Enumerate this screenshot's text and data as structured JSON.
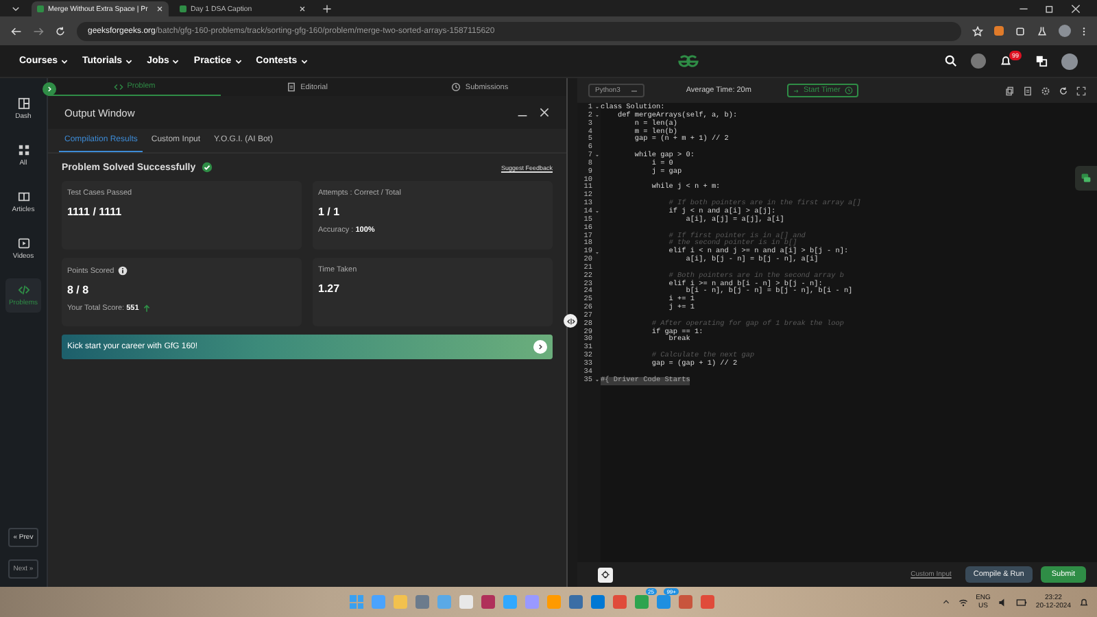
{
  "browser": {
    "tabs": [
      {
        "title": "Merge Without Extra Space | Pr",
        "selected": true
      },
      {
        "title": "Day 1 DSA Caption",
        "selected": false
      }
    ],
    "url": {
      "domain": "geeksforgeeks.org",
      "path": "/batch/gfg-160-problems/track/sorting-gfg-160/problem/merge-two-sorted-arrays-1587115620"
    }
  },
  "site_nav": {
    "menus": [
      "Courses",
      "Tutorials",
      "Jobs",
      "Practice",
      "Contests"
    ],
    "notification_badge": "99"
  },
  "sidebar": {
    "items": [
      {
        "label": "Dash",
        "selected": false
      },
      {
        "label": "All",
        "selected": false
      },
      {
        "label": "Articles",
        "selected": false
      },
      {
        "label": "Videos",
        "selected": false
      },
      {
        "label": "Problems",
        "selected": true
      }
    ],
    "prev": "« Prev",
    "next": "Next »"
  },
  "problem_tabs": [
    {
      "label": "Problem",
      "selected": true
    },
    {
      "label": "Editorial",
      "selected": false
    },
    {
      "label": "Submissions",
      "selected": false
    }
  ],
  "output_window": {
    "title": "Output Window",
    "tabs": [
      {
        "label": "Compilation Results",
        "selected": true
      },
      {
        "label": "Custom Input",
        "selected": false
      },
      {
        "label": "Y.O.G.I. (AI Bot)",
        "selected": false
      }
    ],
    "status": "Problem Solved Successfully",
    "feedback_link": "Suggest Feedback",
    "cards": [
      {
        "label": "Test Cases Passed",
        "value": "1111 / 1111"
      },
      {
        "label": "Attempts : Correct / Total",
        "value": "1 / 1",
        "note": "Accuracy : **100%**"
      },
      {
        "label": "Points Scored",
        "value": "8 / 8",
        "note": "Your Total Score: **551**",
        "info": true,
        "trend_up": true
      },
      {
        "label": "Time Taken",
        "value": "1.27"
      }
    ],
    "banner": "Kick start your career with GfG 160!"
  },
  "editor": {
    "language": "Python3",
    "average_time": "Average Time: 20m",
    "timer_button": "Start Timer",
    "lines": [
      {
        "n": "1",
        "text": "class Solution:",
        "kind": "code",
        "foldable": true
      },
      {
        "n": "2",
        "text": "    def mergeArrays(self, a, b):",
        "kind": "code",
        "foldable": true
      },
      {
        "n": "3",
        "text": "        n = len(a)",
        "kind": "code",
        "foldable": false
      },
      {
        "n": "4",
        "text": "        m = len(b)",
        "kind": "code",
        "foldable": false
      },
      {
        "n": "5",
        "text": "        gap = (n + m + 1) // 2",
        "kind": "code",
        "foldable": false
      },
      {
        "n": "6",
        "kind": "blank"
      },
      {
        "n": "7",
        "text": "        while gap > 0:",
        "kind": "code",
        "foldable": true
      },
      {
        "n": "8",
        "text": "            i = 0",
        "kind": "code",
        "foldable": false
      },
      {
        "n": "9",
        "text": "            j = gap",
        "kind": "code",
        "foldable": false
      },
      {
        "n": "10",
        "kind": "blank"
      },
      {
        "n": "11",
        "text": "            while j < n + m:",
        "kind": "code",
        "foldable": false
      },
      {
        "n": "12",
        "kind": "blank"
      },
      {
        "n": "13",
        "text": "                # If both pointers are in the first array a[]",
        "kind": "comment",
        "foldable": false
      },
      {
        "n": "14",
        "text": "                if j < n and a[i] > a[j]:",
        "kind": "code",
        "foldable": true
      },
      {
        "n": "15",
        "text": "                    a[i], a[j] = a[j], a[i]",
        "kind": "code",
        "foldable": false
      },
      {
        "n": "16",
        "kind": "blank"
      },
      {
        "n": "17",
        "text": "                # If first pointer is in a[] and",
        "kind": "comment",
        "foldable": false
      },
      {
        "n": "18",
        "text": "                # the second pointer is in b[]",
        "kind": "comment",
        "foldable": false
      },
      {
        "n": "19",
        "text": "                elif i < n and j >= n and a[i] > b[j - n]:",
        "kind": "code",
        "foldable": true
      },
      {
        "n": "20",
        "text": "                    a[i], b[j - n] = b[j - n], a[i]",
        "kind": "code",
        "foldable": false
      },
      {
        "n": "21",
        "kind": "blank"
      },
      {
        "n": "22",
        "text": "                # Both pointers are in the second array b",
        "kind": "comment",
        "foldable": false
      },
      {
        "n": "23",
        "text": "                elif i >= n and b[i - n] > b[j - n]:",
        "kind": "code",
        "foldable": false
      },
      {
        "n": "24",
        "text": "                    b[i - n], b[j - n] = b[j - n], b[i - n]",
        "kind": "code",
        "foldable": false
      },
      {
        "n": "25",
        "text": "                i += 1",
        "kind": "code",
        "foldable": false
      },
      {
        "n": "26",
        "text": "                j += 1",
        "kind": "code",
        "foldable": false
      },
      {
        "n": "27",
        "kind": "blank"
      },
      {
        "n": "28",
        "text": "            # After operating for gap of 1 break the loop",
        "kind": "comment",
        "foldable": false
      },
      {
        "n": "29",
        "text": "            if gap == 1:",
        "kind": "code",
        "foldable": false
      },
      {
        "n": "30",
        "text": "                break",
        "kind": "code",
        "foldable": false
      },
      {
        "n": "31",
        "kind": "blank"
      },
      {
        "n": "32",
        "text": "            # Calculate the next gap",
        "kind": "comment",
        "foldable": false
      },
      {
        "n": "33",
        "text": "            gap = (gap + 1) // 2",
        "kind": "code",
        "foldable": false
      },
      {
        "n": "34",
        "kind": "blank"
      },
      {
        "n": "35",
        "text": "#{ Driver Code Starts",
        "kind": "folded",
        "foldable": true
      }
    ],
    "custom_input": "Custom Input",
    "compile_button": "Compile & Run",
    "submit_button": "Submit"
  },
  "taskbar": {
    "badges": [
      "25",
      "99+"
    ],
    "language": "ENG",
    "region": "US",
    "time": "23:22",
    "date": "20-12-2024"
  }
}
